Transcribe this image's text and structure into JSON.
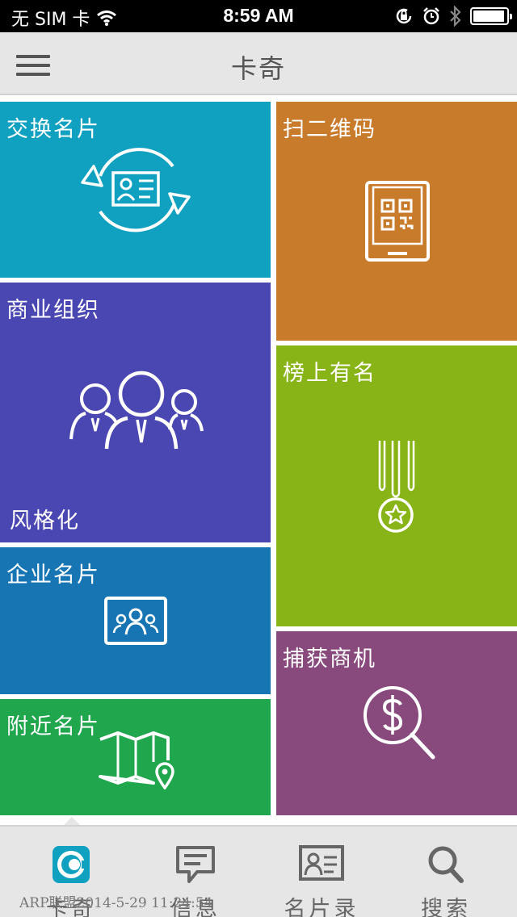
{
  "status_bar": {
    "carrier": "无 SIM 卡",
    "time": "8:59 AM"
  },
  "nav": {
    "title": "卡奇"
  },
  "tiles": {
    "exchange": {
      "label": "交换名片",
      "color": "#10a1c0"
    },
    "scan": {
      "label": "扫二维码",
      "color": "#c97b2c"
    },
    "org": {
      "label": "商业组织",
      "sub_label": "风格化",
      "color": "#4a47b2"
    },
    "rank": {
      "label": "榜上有名",
      "color": "#88b417"
    },
    "company": {
      "label": "企业名片",
      "color": "#1775b4"
    },
    "nearby": {
      "label": "附近名片",
      "color": "#20a64d"
    },
    "business": {
      "label": "捕获商机",
      "color": "#88497c"
    }
  },
  "tabs": [
    {
      "label": "卡奇",
      "icon": "kaqi-logo-icon",
      "active": true
    },
    {
      "label": "信息",
      "icon": "message-icon"
    },
    {
      "label": "名片录",
      "icon": "contact-card-icon"
    },
    {
      "label": "搜索",
      "icon": "search-icon"
    }
  ],
  "watermark": "ARP联盟2014-5-29 11:24:54"
}
